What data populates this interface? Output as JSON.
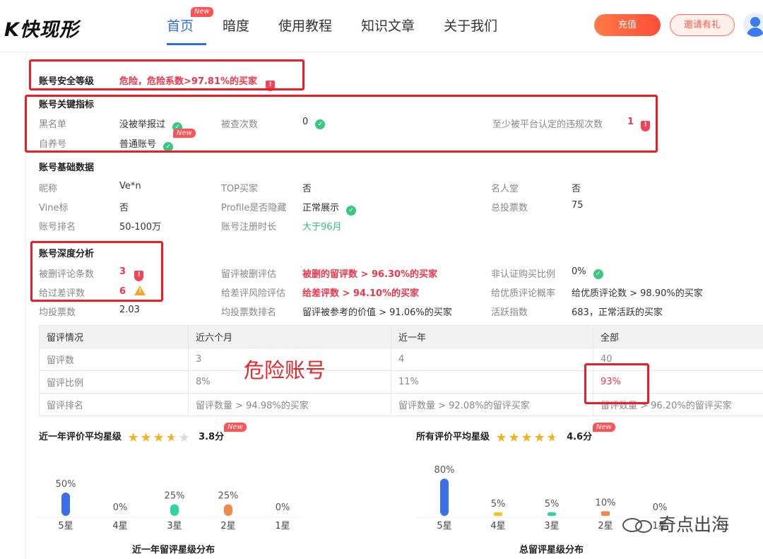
{
  "header": {
    "logo": "K快现形",
    "nav": [
      {
        "label": "首页",
        "badge": "New",
        "active": true
      },
      {
        "label": "暗度"
      },
      {
        "label": "使用教程"
      },
      {
        "label": "知识文章"
      },
      {
        "label": "关于我们"
      }
    ],
    "recharge_label": "充值",
    "invite_label": "邀请有礼"
  },
  "security": {
    "title": "账号安全等级",
    "value": "危险，危险系数>97.81%的买家"
  },
  "key_indicators": {
    "title": "账号关键指标",
    "blacklist_label": "黑名单",
    "blacklist_value": "没被举报过",
    "checked_label": "被查次数",
    "checked_value": "0",
    "violation_label": "至少被平台认定的违规次数",
    "violation_value": "1",
    "self_label": "自养号",
    "self_value": "普通账号",
    "self_badge": "New"
  },
  "basic": {
    "title": "账号基础数据",
    "nickname_label": "昵称",
    "nickname_value": "Ve*n",
    "top_label": "TOP买家",
    "top_value": "否",
    "fame_label": "名人堂",
    "fame_value": "否",
    "vine_label": "Vine标",
    "vine_value": "否",
    "profile_label": "Profile是否隐藏",
    "profile_value": "正常展示",
    "votes_label": "总投票数",
    "votes_value": "75",
    "rank_label": "账号排名",
    "rank_value": "50-100万",
    "reg_label": "账号注册时长",
    "reg_value": "大于96月"
  },
  "deep": {
    "title": "账号深度分析",
    "deleted_label": "被删评论条数",
    "deleted_value": "3",
    "deleted_eval_label": "留评被删评估",
    "deleted_eval_value": "被删的留评数 > 96.30%的买家",
    "nonverified_label": "非认证购买比例",
    "nonverified_value": "0%",
    "bad_label": "给过差评数",
    "bad_value": "6",
    "bad_risk_label": "给差评风险评估",
    "bad_risk_value": "给差评数 > 94.10%的买家",
    "good_label": "给优质评论概率",
    "good_value": "给优质评论数 > 98.90%的买家",
    "avg_label": "均投票数",
    "avg_value": "2.03",
    "avg_rank_label": "均投票数排名",
    "avg_rank_value": "留评被参考的价值 > 91.06%的买家",
    "active_label": "活跃指数",
    "active_value": "683，正常活跃的买家"
  },
  "review_table": {
    "headers": [
      "留评情况",
      "近六个月",
      "近一年",
      "全部"
    ],
    "rows": [
      [
        "留评数",
        "3",
        "4",
        "40"
      ],
      [
        "留评比例",
        "8%",
        "11%",
        "93%"
      ],
      [
        "留评排名",
        "留评数量 > 94.98%的买家",
        "留评数量 > 92.08%的留评买家",
        "留评数量 > 96.20%的留评买家"
      ]
    ]
  },
  "overlay_text": "危险账号",
  "year_stars": {
    "title": "近一年评价平均星级",
    "score": "3.8分",
    "badge": "New",
    "stars": 3.8
  },
  "all_stars": {
    "title": "所有评价平均星级",
    "score": "4.6分",
    "badge": "New",
    "stars": 4.6
  },
  "chart_data": [
    {
      "type": "bar",
      "title": "近一年留评星级分布",
      "categories": [
        "5星",
        "4星",
        "3星",
        "2星",
        "1星"
      ],
      "values": [
        50,
        0,
        25,
        25,
        0
      ],
      "value_labels": [
        "50%",
        "0%",
        "25%",
        "25%",
        "0%"
      ],
      "colors": [
        "#3d6fe8",
        "#f5c518",
        "#2fd3a4",
        "#f08a4b",
        "#cccccc"
      ],
      "ylim": [
        0,
        100
      ]
    },
    {
      "type": "bar",
      "title": "总留评星级分布",
      "categories": [
        "5星",
        "4星",
        "3星",
        "2星",
        "1星"
      ],
      "values": [
        80,
        5,
        5,
        10,
        0
      ],
      "value_labels": [
        "80%",
        "5%",
        "5%",
        "10%",
        "0%"
      ],
      "colors": [
        "#3d6fe8",
        "#f5c518",
        "#2fd3a4",
        "#f08a4b",
        "#cccccc"
      ],
      "ylim": [
        0,
        100
      ]
    }
  ],
  "watermark": "奇点出海"
}
